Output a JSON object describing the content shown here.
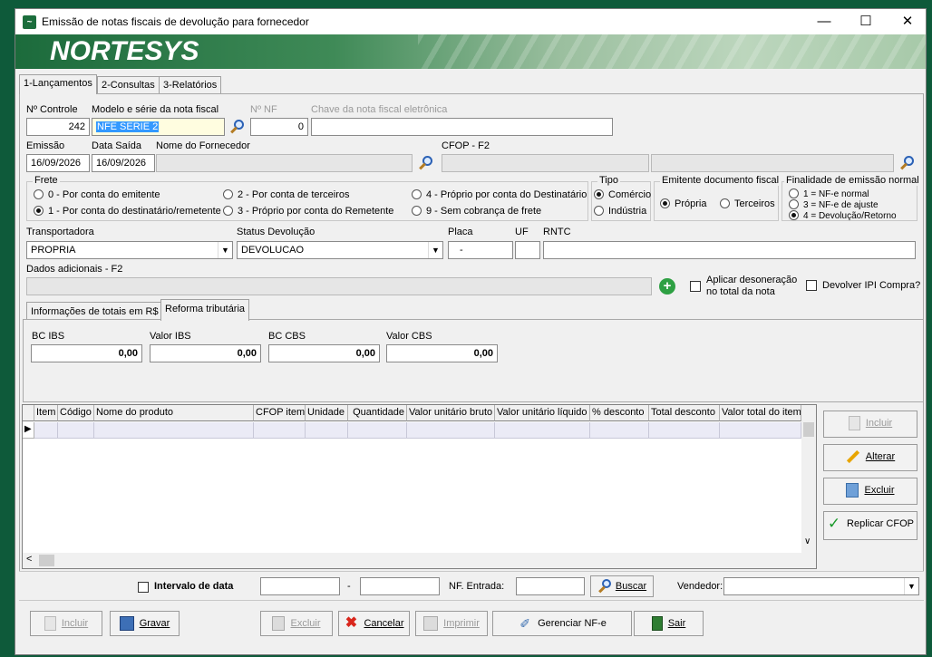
{
  "window": {
    "title": "Emissão de notas fiscais de devolução para fornecedor"
  },
  "banner": {
    "logo": "NORTESYS"
  },
  "tabs": [
    {
      "label": "1-Lançamentos"
    },
    {
      "label": "2-Consultas"
    },
    {
      "label": "3-Relatórios"
    }
  ],
  "form": {
    "controle": {
      "label": "Nº  Controle",
      "value": "242"
    },
    "modelo": {
      "label": "Modelo e série da nota fiscal",
      "value": "NFE SERIE 2"
    },
    "nf": {
      "label": "Nº  NF",
      "value": "0"
    },
    "chave": {
      "label": "Chave da nota fiscal eletrônica",
      "value": ""
    },
    "emissao": {
      "label": "Emissão",
      "value": "16/09/2026"
    },
    "data_saida": {
      "label": "Data Saída",
      "value": "16/09/2026"
    },
    "fornecedor": {
      "label": "Nome do Fornecedor",
      "value": ""
    },
    "cfop": {
      "label": "CFOP - F2",
      "value": ""
    },
    "frete": {
      "label": "Frete",
      "options": [
        "0 - Por conta do emitente",
        "2 - Por conta de terceiros",
        "4 - Próprio por conta do Destinatário",
        "1 - Por conta do destinatário/remetente",
        "3 - Próprio por conta do Remetente",
        "9 - Sem cobrança de frete"
      ],
      "selected": "1 - Por conta do destinatário/remetente"
    },
    "tipo": {
      "label": "Tipo",
      "options": [
        "Comércio",
        "Indústria"
      ],
      "selected": "Comércio"
    },
    "emitente": {
      "label": "Emitente documento fiscal",
      "options": [
        "Própria",
        "Terceiros"
      ],
      "selected": "Própria"
    },
    "finalidade": {
      "label": "Finalidade de emissão normal",
      "options": [
        "1 = NF-e normal",
        "3 = NF-e de ajuste",
        "4 = Devolução/Retorno"
      ],
      "selected": "4 = Devolução/Retorno"
    },
    "transportadora": {
      "label": "Transportadora",
      "value": "PROPRIA"
    },
    "status_devolucao": {
      "label": "Status Devolução",
      "value": "DEVOLUCAO"
    },
    "placa": {
      "label": "Placa",
      "value": "-"
    },
    "uf": {
      "label": "UF",
      "value": ""
    },
    "rntc": {
      "label": "RNTC",
      "value": ""
    },
    "dados_adicionais": {
      "label": "Dados adicionais - F2",
      "value": ""
    },
    "aplicar_desoneracao": {
      "label_line1": "Aplicar desoneração",
      "label_line2": "no total da nota",
      "checked": false
    },
    "devolver_ipi": {
      "label": "Devolver IPI Compra?",
      "checked": false
    }
  },
  "subtabs": [
    {
      "label": "Informações de totais em R$"
    },
    {
      "label": "Reforma tributária"
    }
  ],
  "reforma": {
    "bc_ibs": {
      "label": "BC IBS",
      "value": "0,00"
    },
    "valor_ibs": {
      "label": "Valor IBS",
      "value": "0,00"
    },
    "bc_cbs": {
      "label": "BC CBS",
      "value": "0,00"
    },
    "valor_cbs": {
      "label": "Valor CBS",
      "value": "0,00"
    }
  },
  "grid": {
    "columns": [
      "Item",
      "Código",
      "Nome do produto",
      "CFOP item",
      "Unidade",
      "Quantidade",
      "Valor unitário bruto",
      "Valor unitário líquido",
      "% desconto",
      "Total desconto",
      "Valor total do item"
    ]
  },
  "side_buttons": {
    "incluir": "Incluir",
    "alterar": "Alterar",
    "excluir": "Excluir",
    "replicar": "Replicar CFOP"
  },
  "filter": {
    "intervalo_label": "Intervalo de data",
    "intervalo_checked": false,
    "date_from": "",
    "date_sep": "-",
    "date_to": "",
    "nf_entrada_label": "NF. Entrada:",
    "nf_entrada_value": "",
    "buscar": "Buscar",
    "vendedor_label": "Vendedor:",
    "vendedor_value": ""
  },
  "bottom_buttons": {
    "incluir": "Incluir",
    "gravar": "Gravar",
    "excluir": "Excluir",
    "cancelar": "Cancelar",
    "imprimir": "Imprimir",
    "gerenciar": "Gerenciar NF-e",
    "sair": "Sair"
  }
}
